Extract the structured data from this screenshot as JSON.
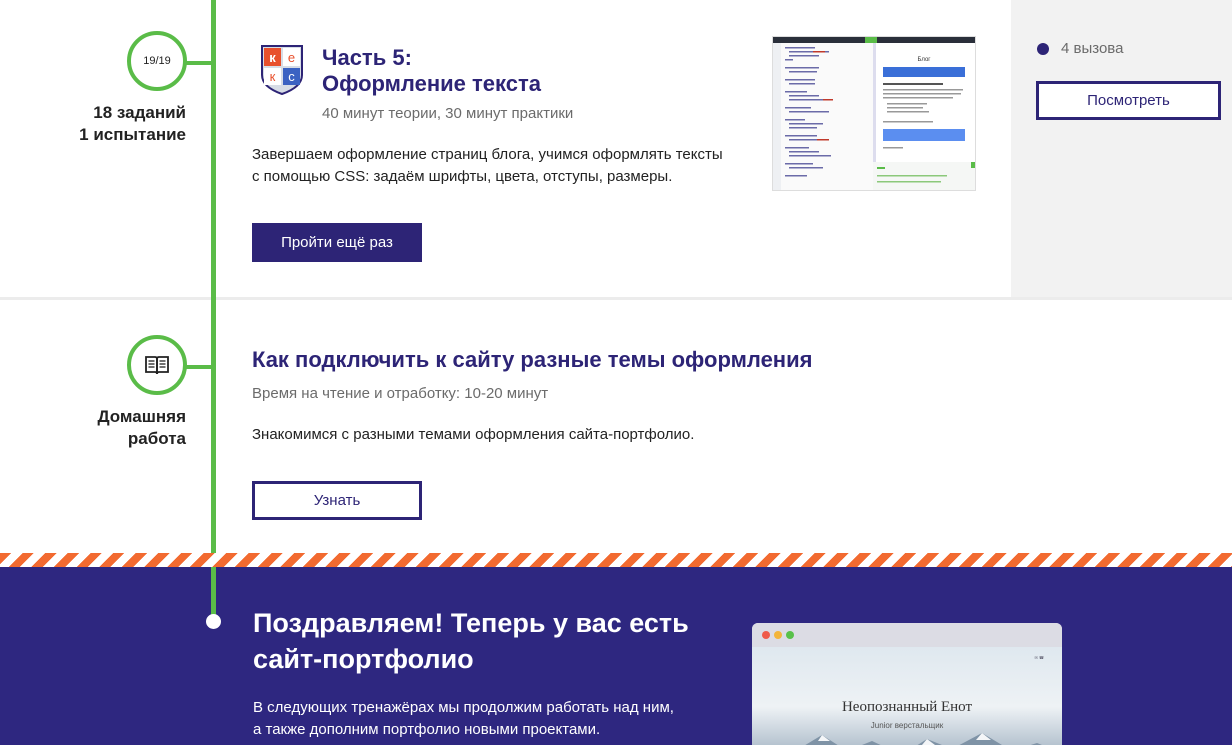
{
  "lesson": {
    "counter": "19/19",
    "left_note_line1": "18 заданий",
    "left_note_line2": "1 испытание",
    "logo_letters": [
      "к",
      "е",
      "к",
      "с"
    ],
    "title_line1": "Часть 5:",
    "title_line2": "Оформление текста",
    "meta": "40 минут теории, 30 минут практики",
    "desc_line1": "Завершаем оформление страниц блога, учимся оформлять тексты",
    "desc_line2": "с помощью CSS: задаём шрифты, цвета, отступы, размеры.",
    "button": "Пройти ещё раз",
    "thumb_preview_title": "Блог",
    "calls_label": "4 вызова",
    "view_button": "Посмотреть"
  },
  "homework": {
    "label_line1": "Домашняя",
    "label_line2": "работа",
    "title": "Как подключить к сайту разные темы оформления",
    "meta": "Время на чтение и отработку: 10-20 минут",
    "desc": "Знакомимся с разными темами оформления сайта-портфолио.",
    "button": "Узнать"
  },
  "congrats": {
    "title_line1": "Поздравляем! Теперь у вас есть",
    "title_line2": "сайт-портфолио",
    "desc_line1": "В следующих тренажёрах мы продолжим работать над ним,",
    "desc_line2": "а также дополним портфолио новыми проектами.",
    "preview_name": "Неопознанный Енот",
    "preview_sub": "Junior верстальщик"
  },
  "colors": {
    "brand": "#2d2476",
    "timeline": "#5abc48",
    "stripe": "#f26a30",
    "congrats_bg": "#2e2780"
  }
}
